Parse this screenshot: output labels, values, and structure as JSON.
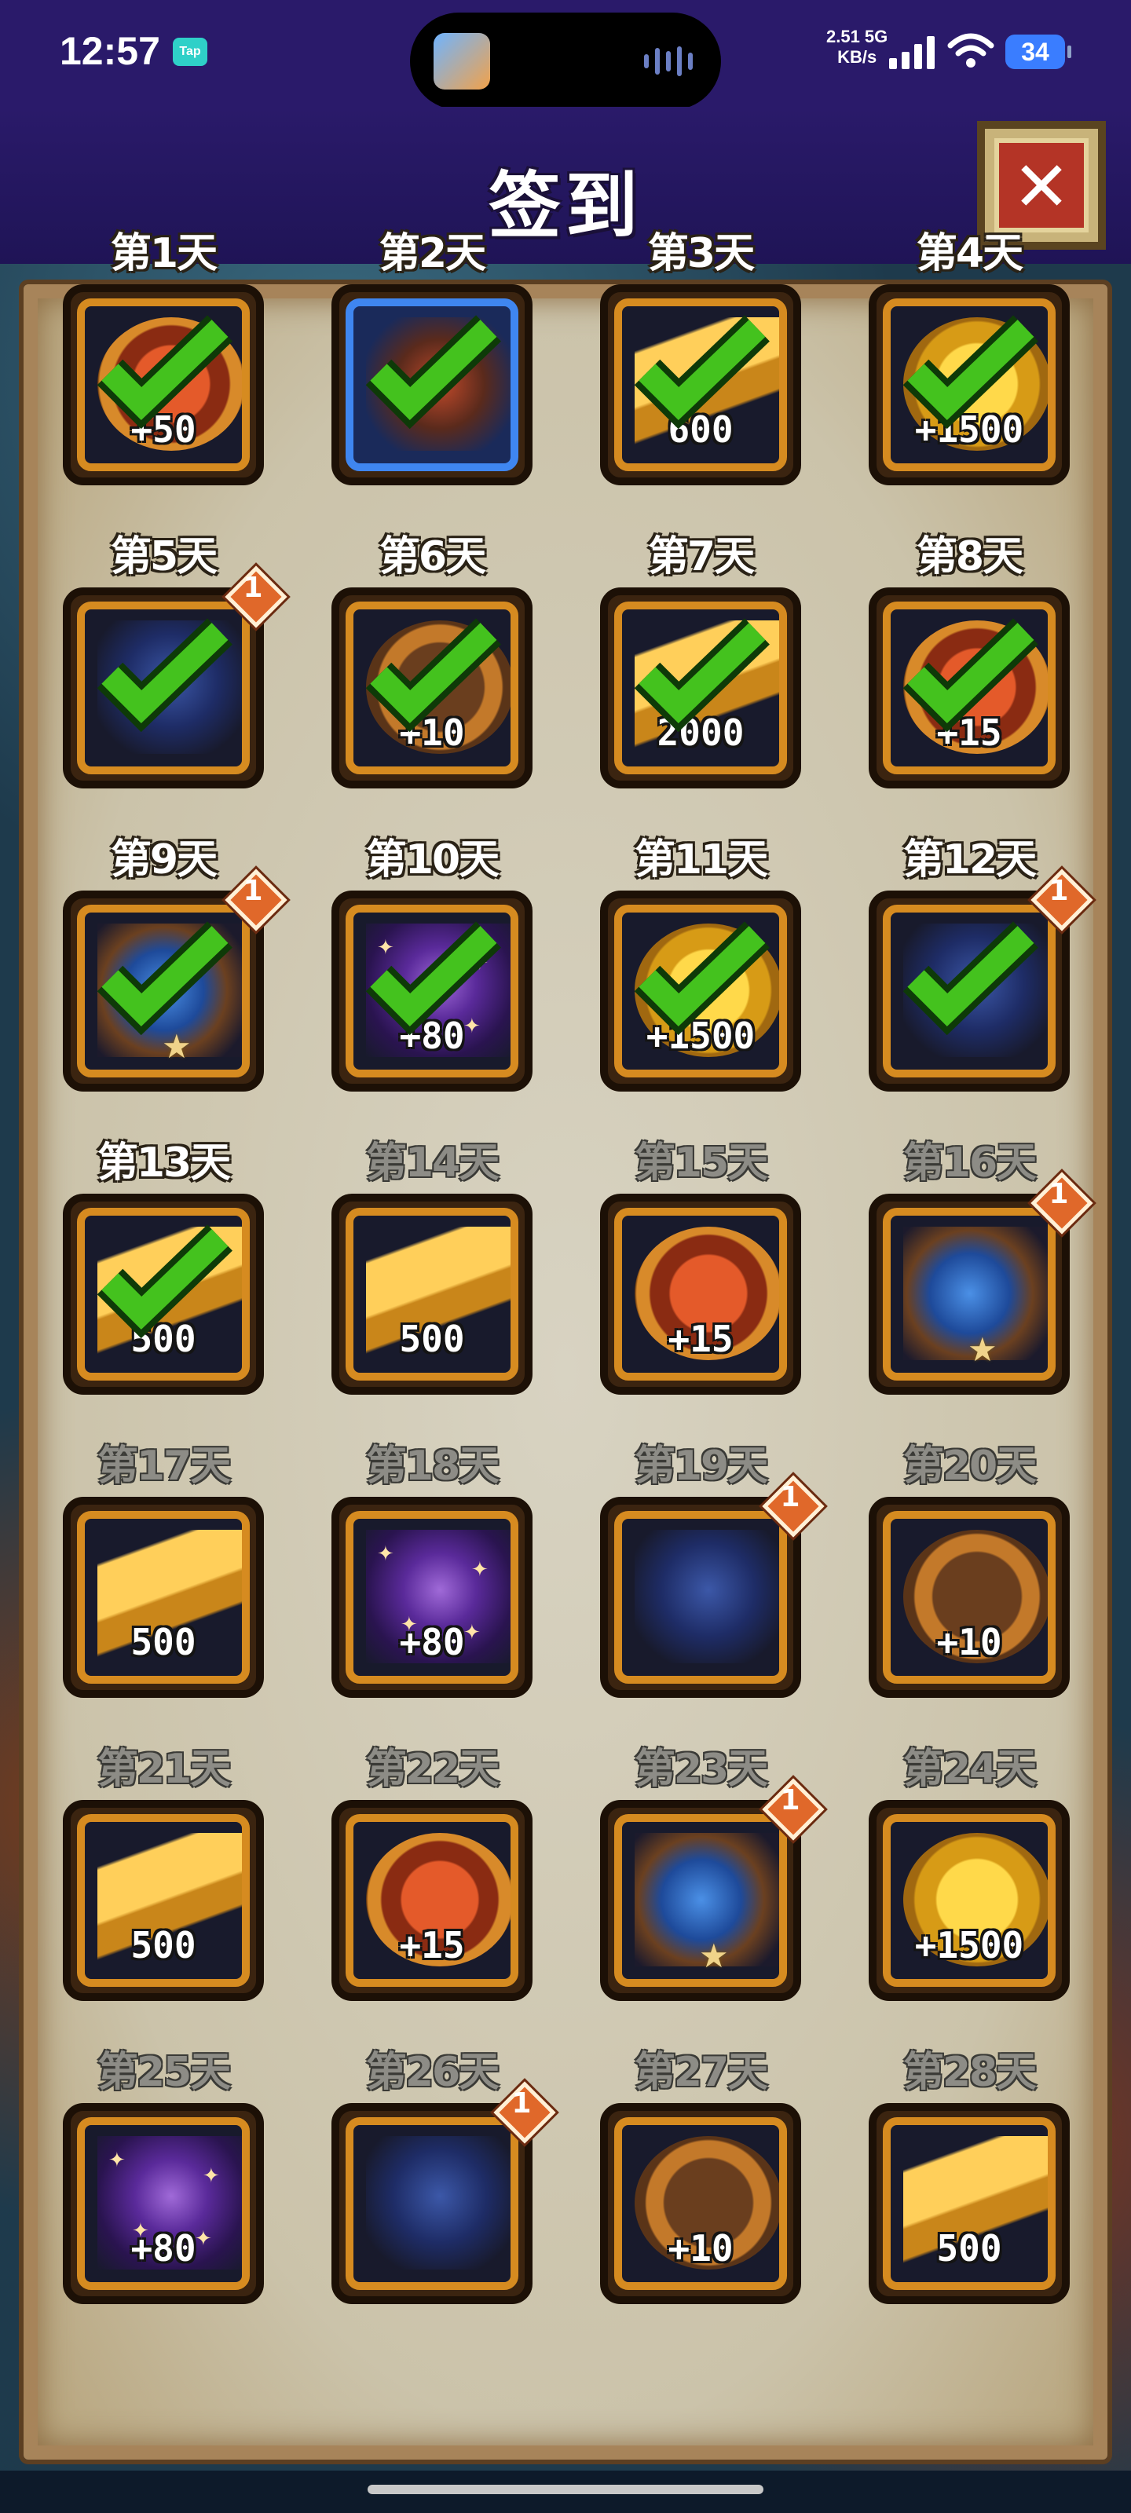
{
  "status_bar": {
    "time": "12:57",
    "app_badge": "Tap",
    "net_speed_top": "2.51 5G",
    "net_speed_bottom": "KB/s",
    "battery": "34"
  },
  "header": {
    "title": "签到"
  },
  "days": [
    {
      "label": "第1天",
      "amount": "+50",
      "item": "coin-red",
      "claimed": true,
      "badge": "",
      "star": false,
      "frame": "gold"
    },
    {
      "label": "第2天",
      "amount": "",
      "item": "hero",
      "claimed": true,
      "badge": "",
      "star": false,
      "frame": "blue"
    },
    {
      "label": "第3天",
      "amount": "600",
      "item": "gold-bar",
      "claimed": true,
      "badge": "",
      "star": false,
      "frame": "gold"
    },
    {
      "label": "第4天",
      "amount": "+1500",
      "item": "coin-gold",
      "claimed": true,
      "badge": "",
      "star": false,
      "frame": "gold"
    },
    {
      "label": "第5天",
      "amount": "",
      "item": "demon",
      "claimed": true,
      "badge": "1",
      "star": false,
      "frame": "gold"
    },
    {
      "label": "第6天",
      "amount": "+10",
      "item": "coin-anvil",
      "claimed": true,
      "badge": "",
      "star": false,
      "frame": "gold"
    },
    {
      "label": "第7天",
      "amount": "2000",
      "item": "gold-bar",
      "claimed": true,
      "badge": "",
      "star": false,
      "frame": "gold"
    },
    {
      "label": "第8天",
      "amount": "+15",
      "item": "coin-red",
      "claimed": true,
      "badge": "",
      "star": false,
      "frame": "gold"
    },
    {
      "label": "第9天",
      "amount": "",
      "item": "gauntlet",
      "claimed": true,
      "badge": "1",
      "star": true,
      "frame": "gold"
    },
    {
      "label": "第10天",
      "amount": "+80",
      "item": "nebula",
      "claimed": true,
      "badge": "",
      "star": false,
      "frame": "gold"
    },
    {
      "label": "第11天",
      "amount": "+1500",
      "item": "coin-gold",
      "claimed": true,
      "badge": "",
      "star": false,
      "frame": "gold"
    },
    {
      "label": "第12天",
      "amount": "",
      "item": "demon",
      "claimed": true,
      "badge": "1",
      "star": false,
      "frame": "gold"
    },
    {
      "label": "第13天",
      "amount": "500",
      "item": "gold-bar",
      "claimed": true,
      "badge": "",
      "star": false,
      "frame": "gold"
    },
    {
      "label": "第14天",
      "amount": "500",
      "item": "gold-bar",
      "claimed": false,
      "badge": "",
      "star": false,
      "frame": "gold"
    },
    {
      "label": "第15天",
      "amount": "+15",
      "item": "coin-red",
      "claimed": false,
      "badge": "",
      "star": false,
      "frame": "gold"
    },
    {
      "label": "第16天",
      "amount": "",
      "item": "gauntlet",
      "claimed": false,
      "badge": "1",
      "star": true,
      "frame": "gold"
    },
    {
      "label": "第17天",
      "amount": "500",
      "item": "gold-bar",
      "claimed": false,
      "badge": "",
      "star": false,
      "frame": "gold"
    },
    {
      "label": "第18天",
      "amount": "+80",
      "item": "nebula",
      "claimed": false,
      "badge": "",
      "star": false,
      "frame": "gold"
    },
    {
      "label": "第19天",
      "amount": "",
      "item": "demon",
      "claimed": false,
      "badge": "1",
      "star": false,
      "frame": "gold"
    },
    {
      "label": "第20天",
      "amount": "+10",
      "item": "coin-anvil",
      "claimed": false,
      "badge": "",
      "star": false,
      "frame": "gold"
    },
    {
      "label": "第21天",
      "amount": "500",
      "item": "gold-bar",
      "claimed": false,
      "badge": "",
      "star": false,
      "frame": "gold"
    },
    {
      "label": "第22天",
      "amount": "+15",
      "item": "coin-red",
      "claimed": false,
      "badge": "",
      "star": false,
      "frame": "gold"
    },
    {
      "label": "第23天",
      "amount": "",
      "item": "gauntlet",
      "claimed": false,
      "badge": "1",
      "star": true,
      "frame": "gold"
    },
    {
      "label": "第24天",
      "amount": "+1500",
      "item": "coin-gold",
      "claimed": false,
      "badge": "",
      "star": false,
      "frame": "gold"
    },
    {
      "label": "第25天",
      "amount": "+80",
      "item": "nebula",
      "claimed": false,
      "badge": "",
      "star": false,
      "frame": "gold"
    },
    {
      "label": "第26天",
      "amount": "",
      "item": "demon",
      "claimed": false,
      "badge": "1",
      "star": false,
      "frame": "gold"
    },
    {
      "label": "第27天",
      "amount": "+10",
      "item": "coin-anvil",
      "claimed": false,
      "badge": "",
      "star": false,
      "frame": "gold"
    },
    {
      "label": "第28天",
      "amount": "500",
      "item": "gold-bar",
      "claimed": false,
      "badge": "",
      "star": false,
      "frame": "gold"
    }
  ],
  "colors": {
    "header_bg": "#2a1a6a",
    "frame_gold": "#d68b20",
    "frame_blue": "#3f86f0",
    "check_green": "#44c21e",
    "close_red": "#b43426"
  },
  "icons": {
    "close": "close-icon",
    "check": "check-icon",
    "badge": "badge-icon",
    "star": "star-icon"
  }
}
